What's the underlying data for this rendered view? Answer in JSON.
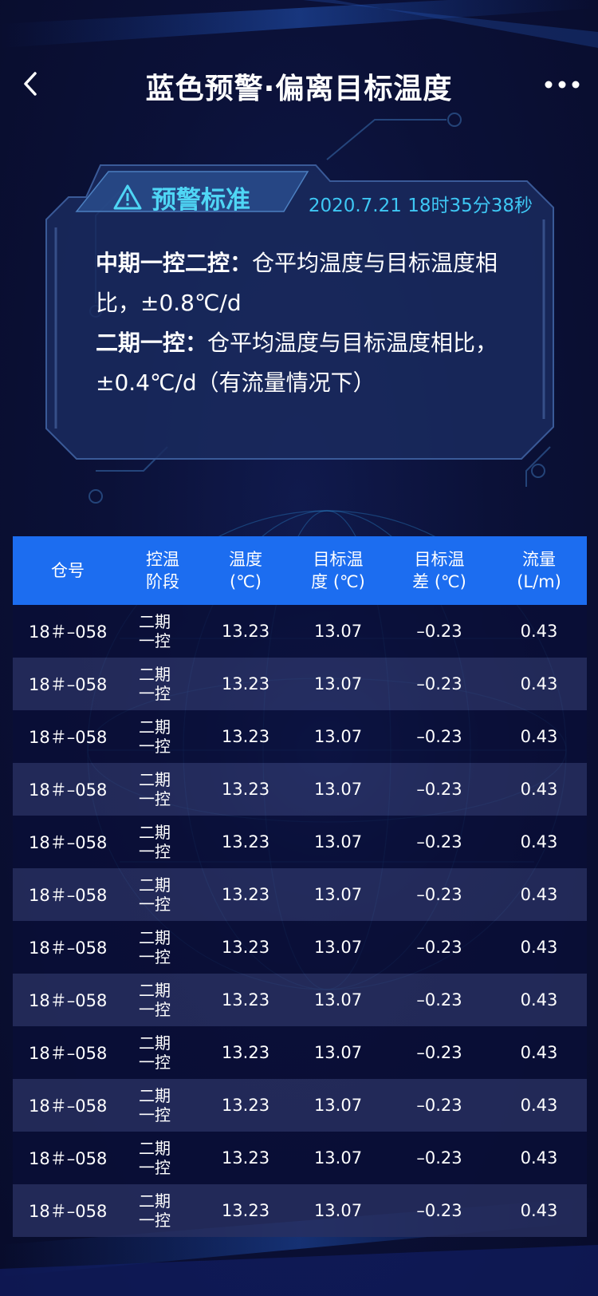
{
  "nav": {
    "title": "蓝色预警·偏离目标温度"
  },
  "card": {
    "tag_label": "预警标准",
    "timestamp": "2020.7.21 18时35分38秒",
    "rule1_head": "中期一控二控：",
    "rule1_body": "仓平均温度与目标温度相比，±0.8℃/d",
    "rule2_head": "二期一控：",
    "rule2_body": "仓平均温度与目标温度相比，±0.4℃/d（有流量情况下）"
  },
  "table": {
    "headers": [
      "仓号",
      "控温\n阶段",
      "温度\n(℃)",
      "目标温\n度 (℃)",
      "目标温\n差 (℃)",
      "流量\n(L/m)"
    ],
    "rows": [
      [
        "18＃–058",
        "二期\n一控",
        "13.23",
        "13.07",
        "–0.23",
        "0.43"
      ],
      [
        "18＃–058",
        "二期\n一控",
        "13.23",
        "13.07",
        "–0.23",
        "0.43"
      ],
      [
        "18＃–058",
        "二期\n一控",
        "13.23",
        "13.07",
        "–0.23",
        "0.43"
      ],
      [
        "18＃–058",
        "二期\n一控",
        "13.23",
        "13.07",
        "–0.23",
        "0.43"
      ],
      [
        "18＃–058",
        "二期\n一控",
        "13.23",
        "13.07",
        "–0.23",
        "0.43"
      ],
      [
        "18＃–058",
        "二期\n一控",
        "13.23",
        "13.07",
        "–0.23",
        "0.43"
      ],
      [
        "18＃–058",
        "二期\n一控",
        "13.23",
        "13.07",
        "–0.23",
        "0.43"
      ],
      [
        "18＃–058",
        "二期\n一控",
        "13.23",
        "13.07",
        "–0.23",
        "0.43"
      ],
      [
        "18＃–058",
        "二期\n一控",
        "13.23",
        "13.07",
        "–0.23",
        "0.43"
      ],
      [
        "18＃–058",
        "二期\n一控",
        "13.23",
        "13.07",
        "–0.23",
        "0.43"
      ],
      [
        "18＃–058",
        "二期\n一控",
        "13.23",
        "13.07",
        "–0.23",
        "0.43"
      ],
      [
        "18＃–058",
        "二期\n一控",
        "13.23",
        "13.07",
        "–0.23",
        "0.43"
      ]
    ]
  },
  "colors": {
    "background": "#0b1138",
    "header_bar": "#1c6df0",
    "accent_cyan": "#3ec7f4",
    "row_dark": "#0a0f37",
    "row_light": "#282f60"
  },
  "icons": {
    "back": "chevron-left-icon",
    "more": "more-dots-icon",
    "warning": "warning-triangle-icon"
  }
}
